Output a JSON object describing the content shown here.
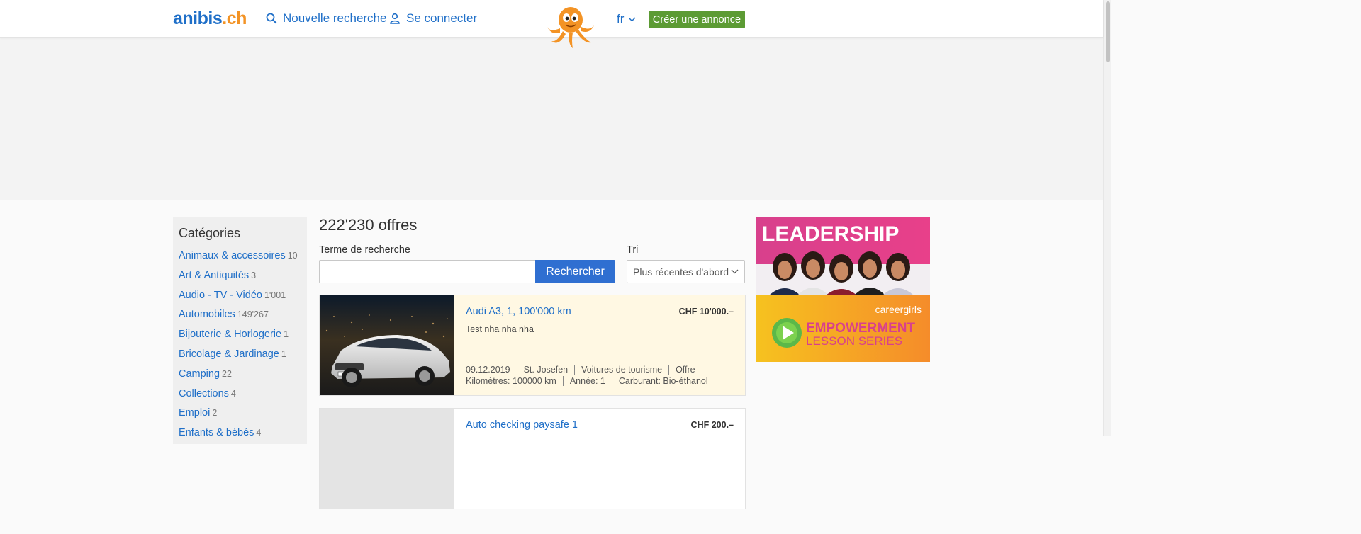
{
  "header": {
    "logo_main": "anibis",
    "logo_tld": ".ch",
    "nav_search": "Nouvelle recherche",
    "nav_login": "Se connecter",
    "language": "fr",
    "create_ad": "Créer une annonce"
  },
  "sidebar": {
    "title": "Catégories",
    "items": [
      {
        "label": "Animaux & accessoires",
        "count": "10"
      },
      {
        "label": "Art & Antiquités",
        "count": "3"
      },
      {
        "label": "Audio - TV - Vidéo",
        "count": "1'001"
      },
      {
        "label": "Automobiles",
        "count": "149'267"
      },
      {
        "label": "Bijouterie & Horlogerie",
        "count": "1"
      },
      {
        "label": "Bricolage & Jardinage",
        "count": "1"
      },
      {
        "label": "Camping",
        "count": "22"
      },
      {
        "label": "Collections",
        "count": "4"
      },
      {
        "label": "Emploi",
        "count": "2"
      },
      {
        "label": "Enfants & bébés",
        "count": "4"
      }
    ]
  },
  "main": {
    "results_count": "222'230 offres",
    "search_label": "Terme de recherche",
    "search_value": "",
    "search_button": "Rechercher",
    "sort_label": "Tri",
    "sort_value": "Plus récentes d'abord"
  },
  "listings": [
    {
      "title": "Audi A3, 1, 100'000 km",
      "price": "CHF 10'000.–",
      "description": "Test nha nha nha",
      "date": "09.12.2019",
      "location": "St. Josefen",
      "category": "Voitures de tourisme",
      "type": "Offre",
      "mileage": "Kilomètres: 100000 km",
      "year": "Année: 1",
      "fuel": "Carburant: Bio-éthanol"
    },
    {
      "title": "Auto checking paysafe 1",
      "price": "CHF 200.–"
    }
  ],
  "right_ad": {
    "headline": "LEADERSHIP",
    "brand": "careergirls",
    "line1": "EMPOWERMENT",
    "line2": "LESSON SERIES"
  },
  "colors": {
    "link": "#1f6fc8",
    "logo_orange": "#f39325",
    "create_button": "#5c9b34",
    "search_button": "#2f6fd1",
    "highlight_listing": "#fff8e3"
  }
}
